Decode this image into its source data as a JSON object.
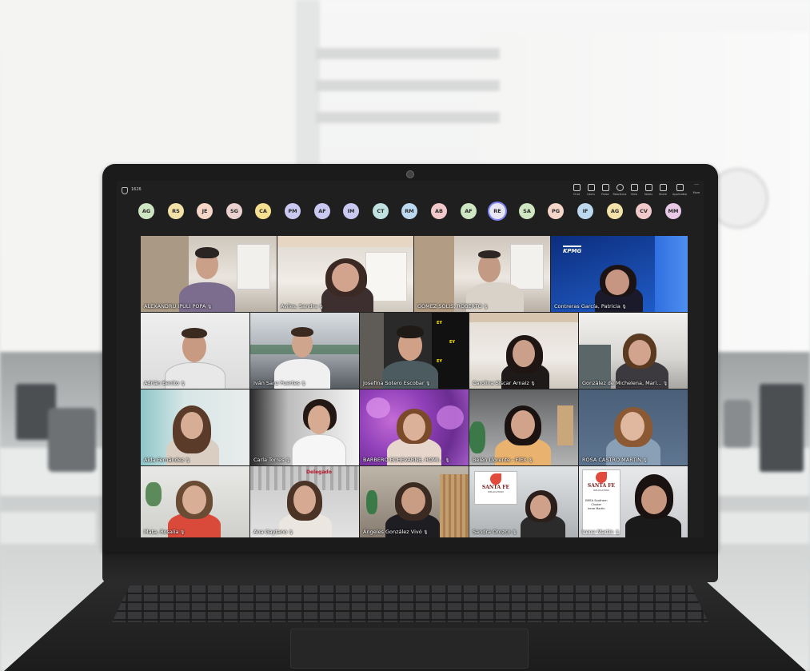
{
  "meeting": {
    "timer": "1626"
  },
  "toolbar": {
    "buttons": [
      {
        "label": "Chat",
        "icon": "chat-icon"
      },
      {
        "label": "Users",
        "icon": "people-icon"
      },
      {
        "label": "Raise",
        "icon": "hand-icon"
      },
      {
        "label": "Reactions",
        "icon": "smile-icon"
      },
      {
        "label": "View",
        "icon": "view-icon"
      },
      {
        "label": "Notes",
        "icon": "notes-icon"
      },
      {
        "label": "Share",
        "icon": "share-icon"
      },
      {
        "label": "Applications",
        "icon": "apps-icon"
      },
      {
        "label": "More",
        "icon": "more-icon"
      }
    ]
  },
  "avatars": [
    {
      "initials": "AG",
      "color": "#cfe6c3"
    },
    {
      "initials": "RS",
      "color": "#f3e2a8"
    },
    {
      "initials": "JE",
      "color": "#f6d6c9"
    },
    {
      "initials": "SG",
      "color": "#e9d2cf"
    },
    {
      "initials": "CA",
      "color": "#f6e08f"
    },
    {
      "initials": "PM",
      "color": "#c9c8f1"
    },
    {
      "initials": "AF",
      "color": "#c9c8f1"
    },
    {
      "initials": "IM",
      "color": "#c9c8f1"
    },
    {
      "initials": "CT",
      "color": "#bfe2e0"
    },
    {
      "initials": "RM",
      "color": "#bcd9ef"
    },
    {
      "initials": "AB",
      "color": "#f2c9cb"
    },
    {
      "initials": "AF",
      "color": "#cfe6c3"
    },
    {
      "initials": "RE",
      "color": "#e7e6f1",
      "active": true
    },
    {
      "initials": "SA",
      "color": "#cfe6c3"
    },
    {
      "initials": "PG",
      "color": "#f6d6c9"
    },
    {
      "initials": "IF",
      "color": "#bcd9ef"
    },
    {
      "initials": "AG",
      "color": "#f3e2a8"
    },
    {
      "initials": "CV",
      "color": "#f2c9cb"
    },
    {
      "initials": "MM",
      "color": "#e9c8e6"
    }
  ],
  "participants": {
    "r1": [
      "ALEXANDRU IPULI POPA",
      "Aviles, Sandra",
      "GOMEZ SOLIS, ROBERTO",
      "Contreras García, Patricia"
    ],
    "r2": [
      "Adrián Benito",
      "Iván Sanz Fuertes",
      "Josefina Sotero Escobar",
      "Carolina Siscar Arnaiz",
      "González de Michelena, Mari..."
    ],
    "r3": [
      "Aida Fernández",
      "Carla Torres",
      "BARBERO ECHEVARNE, ROMI...",
      "Belén Llorente - FIEX",
      "ROSA CASTRO MARTIN"
    ],
    "r4": [
      "Mata, Rosalía",
      "Ana Gaytano",
      "Ángeles González Vivó",
      "Sandra Orozco",
      "Irene Martin"
    ]
  },
  "mic_icon": "mic-icon",
  "tile_logos": {
    "kpmg": "KPMG",
    "ey": "EY",
    "delegado": "Delegado",
    "santa_fe": "SANTA FE",
    "santa_fe_sub": "RELOCATION",
    "poster": [
      "EMEA Southern",
      "Cluster",
      "Irene Martin"
    ]
  }
}
